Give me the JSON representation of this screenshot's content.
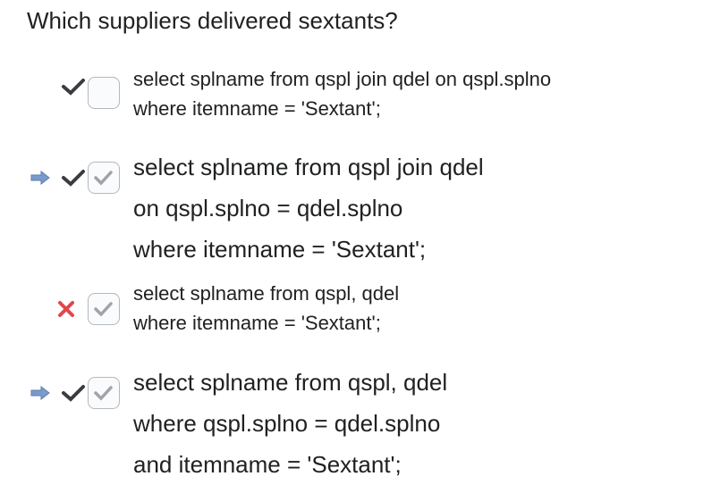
{
  "question": "Which suppliers delivered sextants?",
  "options": [
    {
      "lines": [
        "select splname from qspl join qdel on qspl.splno",
        "where itemname = 'Sextant';"
      ],
      "selected": false,
      "result": "correct",
      "arrow": false
    },
    {
      "lines": [
        "select splname from qspl join qdel",
        "on qspl.splno = qdel.splno",
        "where itemname = 'Sextant';"
      ],
      "selected": true,
      "result": "correct",
      "arrow": true
    },
    {
      "lines": [
        "select splname from qspl, qdel",
        "where itemname = 'Sextant';"
      ],
      "selected": true,
      "result": "incorrect",
      "arrow": false
    },
    {
      "lines": [
        "select splname from qspl, qdel",
        "where qspl.splno = qdel.splno",
        "and itemname = 'Sextant';"
      ],
      "selected": true,
      "result": "correct",
      "arrow": true
    }
  ],
  "colors": {
    "arrow": "#7a9ccc",
    "check": "#3a3c3f",
    "cross": "#e0474c",
    "box_check": "#a0a3a7"
  }
}
